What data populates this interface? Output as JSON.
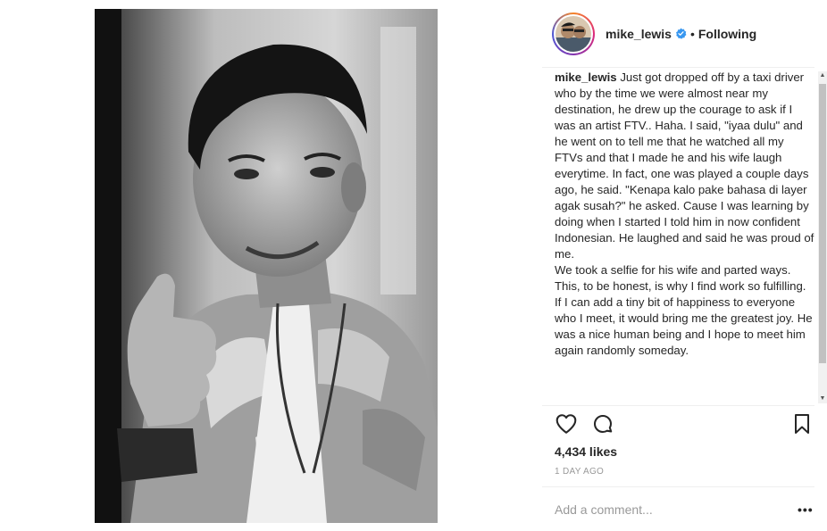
{
  "post": {
    "photo_icon": "portrait-photo",
    "header": {
      "username": "mike_lewis",
      "verified_icon": "verified-badge-icon",
      "separator": "•",
      "follow_status": "Following"
    },
    "caption": {
      "username": "mike_lewis",
      "text": " Just got dropped off by a taxi driver who by the time we were almost near my destination, he drew up the courage to ask if I was an artist FTV.. Haha. I said, \"iyaa dulu\" and he went on to tell me that he watched all my FTVs and that I made he and his wife laugh everytime. In fact, one was played a couple days ago, he said. \"Kenapa kalo pake bahasa di layer agak susah?\" he asked. Cause I was learning by doing when I started I told him in now confident Indonesian. He laughed and said he was proud of me.\nWe took a selfie for his wife and parted ways.\nThis, to be honest, is why I find work so fulfilling. If I can add a tiny bit of happiness to everyone who I meet, it would bring me the greatest joy. He was a nice human being and I hope to meet him again randomly someday."
    },
    "actions": {
      "like_icon": "heart-icon",
      "comment_icon": "comment-bubble-icon",
      "save_icon": "bookmark-icon"
    },
    "likes": "4,434 likes",
    "timestamp": "1 DAY AGO",
    "comment": {
      "placeholder": "Add a comment...",
      "more_label": "•••"
    },
    "colors": {
      "text": "#262626",
      "muted": "#999999",
      "divider": "#efefef",
      "verified": "#3897f0"
    }
  }
}
